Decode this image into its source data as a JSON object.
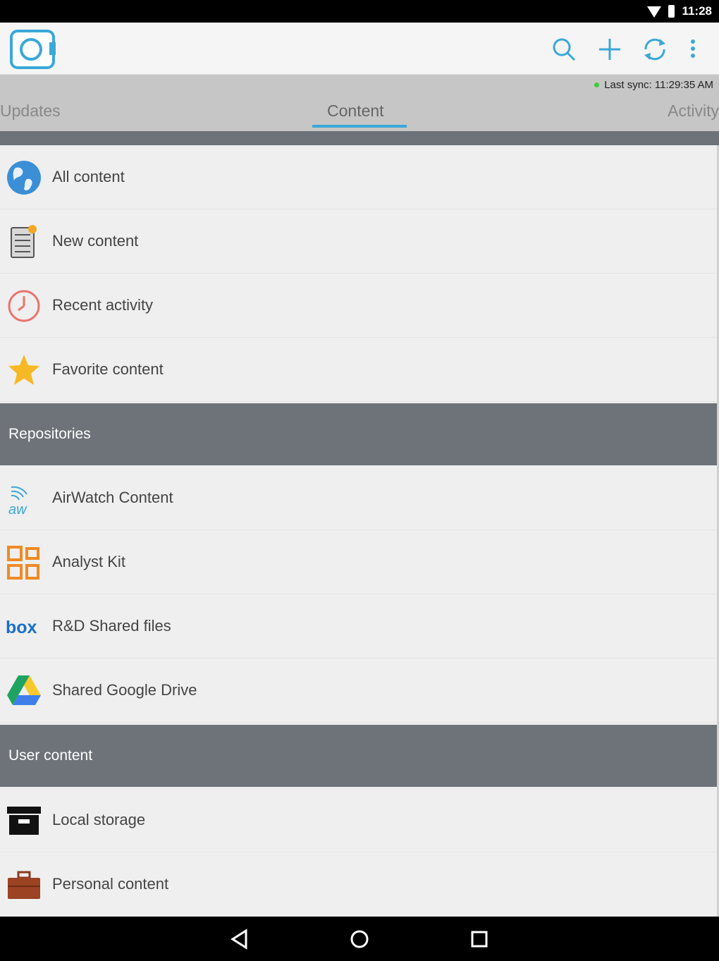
{
  "status_bar": {
    "time": "11:28"
  },
  "toolbar": {
    "search_icon": "search-icon",
    "add_icon": "plus-icon",
    "sync_icon": "sync-icon",
    "more_icon": "more-vert-icon",
    "accent_color": "#3aa8d8"
  },
  "sync": {
    "label": "Last sync: 11:29:35 AM"
  },
  "tabs": [
    {
      "label": "Updates"
    },
    {
      "label": "Content"
    },
    {
      "label": "Activity"
    }
  ],
  "content_items": [
    {
      "label": "All content",
      "icon": "globe-icon"
    },
    {
      "label": "New content",
      "icon": "document-new-icon"
    },
    {
      "label": "Recent activity",
      "icon": "clock-icon"
    },
    {
      "label": "Favorite content",
      "icon": "star-icon"
    }
  ],
  "repositories": {
    "header": "Repositories",
    "items": [
      {
        "label": "AirWatch Content",
        "icon": "airwatch-icon"
      },
      {
        "label": "Analyst Kit",
        "icon": "kit-icon"
      },
      {
        "label": "R&D Shared files",
        "icon": "box-icon",
        "icon_text": "box"
      },
      {
        "label": "Shared Google Drive",
        "icon": "google-drive-icon"
      }
    ]
  },
  "user_content": {
    "header": "User content",
    "items": [
      {
        "label": "Local storage",
        "icon": "archive-icon"
      },
      {
        "label": "Personal content",
        "icon": "briefcase-icon"
      }
    ]
  }
}
